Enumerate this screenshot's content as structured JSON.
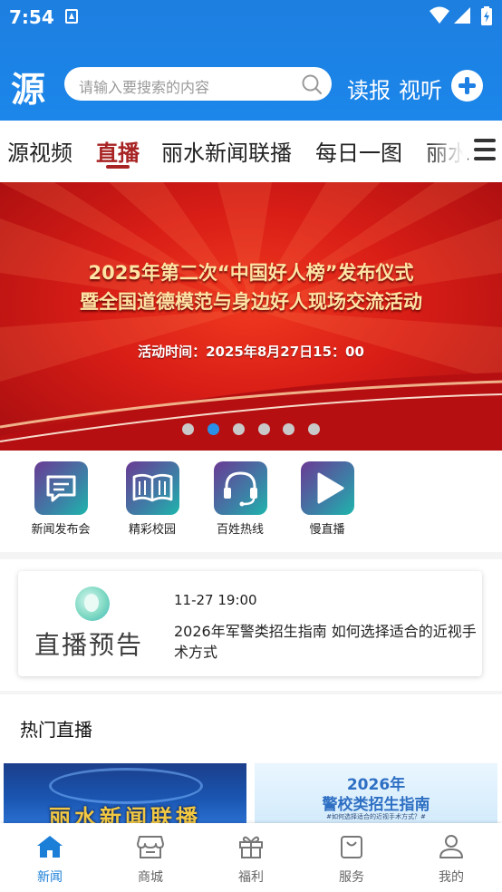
{
  "status_bar": {
    "time": "7:54"
  },
  "header": {
    "logo": "源",
    "search_placeholder": "请输入要搜索的内容",
    "links": [
      "读报",
      "视听"
    ]
  },
  "tabs": [
    {
      "label": "源视频",
      "active": false
    },
    {
      "label": "直播",
      "active": true
    },
    {
      "label": "丽水新闻联播",
      "active": false
    },
    {
      "label": "每日一图",
      "active": false
    },
    {
      "label": "丽水",
      "active": false
    }
  ],
  "banner": {
    "line1": "2025年第二次“中国好人榜”发布仪式",
    "line2": "暨全国道德模范与身边好人现场交流活动",
    "time": "活动时间：2025年8月27日15：00",
    "slide_count": 6,
    "active_slide": 2
  },
  "quick_entries": [
    {
      "label": "新闻发布会",
      "icon": "chat-icon"
    },
    {
      "label": "精彩校园",
      "icon": "book-icon"
    },
    {
      "label": "百姓热线",
      "icon": "headset-icon"
    },
    {
      "label": "慢直播",
      "icon": "play-icon"
    }
  ],
  "live_preview": {
    "badge": "直播预告",
    "time": "11-27 19:00",
    "title": "2026年军警类招生指南 如何选择适合的近视手术方式"
  },
  "hot_live": {
    "heading": "热门直播",
    "thumbs": [
      {
        "text": "丽水新闻联播"
      },
      {
        "line1": "2026年",
        "line2": "警校类招生指南",
        "line3": "#如何选择适合的近视手术方式？#"
      }
    ]
  },
  "bottom_nav": [
    {
      "label": "新闻",
      "icon": "home-icon",
      "active": true
    },
    {
      "label": "商城",
      "icon": "shop-icon",
      "active": false
    },
    {
      "label": "福利",
      "icon": "gift-icon",
      "active": false
    },
    {
      "label": "服务",
      "icon": "bag-icon",
      "active": false
    },
    {
      "label": "我的",
      "icon": "user-icon",
      "active": false
    }
  ],
  "colors": {
    "header_blue": "#1d7fe0",
    "active_tab": "#a82323",
    "nav_active": "#1b7fd8"
  }
}
